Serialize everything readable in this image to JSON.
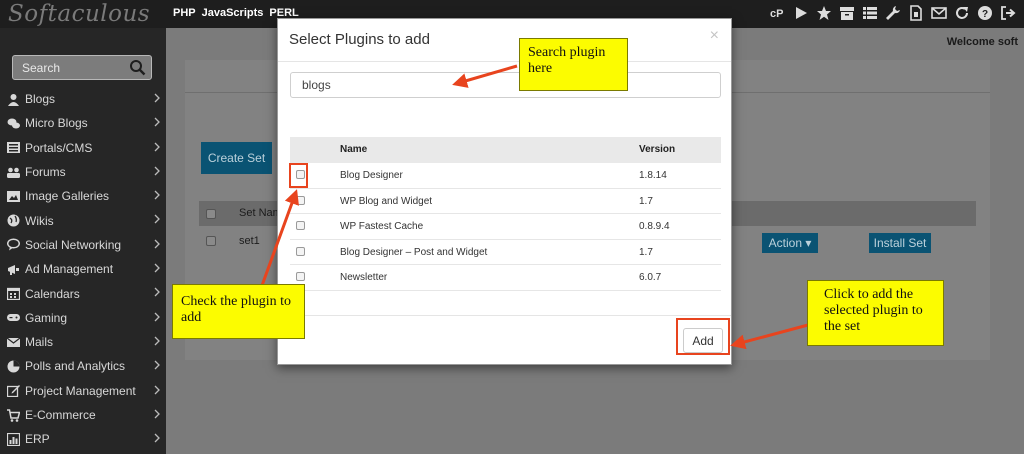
{
  "app": {
    "logo": "Softaculous",
    "top_tabs": [
      "PHP",
      "JavaScripts",
      "PERL"
    ],
    "top_icons": [
      "cpanel-icon",
      "play-icon",
      "star-icon",
      "archive-icon",
      "list-icon",
      "wrench-icon",
      "document-icon",
      "envelope-icon",
      "refresh-icon",
      "help-icon",
      "logout-icon"
    ],
    "welcome": "Welcome soft"
  },
  "sidebar": {
    "search_placeholder": "Search",
    "items": [
      {
        "label": "Blogs",
        "icon": "user-icon"
      },
      {
        "label": "Micro Blogs",
        "icon": "comments-icon"
      },
      {
        "label": "Portals/CMS",
        "icon": "list-icon"
      },
      {
        "label": "Forums",
        "icon": "group-icon"
      },
      {
        "label": "Image Galleries",
        "icon": "image-icon"
      },
      {
        "label": "Wikis",
        "icon": "globe-icon"
      },
      {
        "label": "Social Networking",
        "icon": "chat-icon"
      },
      {
        "label": "Ad Management",
        "icon": "bullhorn-icon"
      },
      {
        "label": "Calendars",
        "icon": "calendar-icon"
      },
      {
        "label": "Gaming",
        "icon": "gamepad-icon"
      },
      {
        "label": "Mails",
        "icon": "mail-icon"
      },
      {
        "label": "Polls and Analytics",
        "icon": "chart-icon"
      },
      {
        "label": "Project Management",
        "icon": "edit-icon"
      },
      {
        "label": "E-Commerce",
        "icon": "cart-icon"
      },
      {
        "label": "ERP",
        "icon": "bar-chart-icon"
      }
    ]
  },
  "background": {
    "create_set_label": "Create Set",
    "set_name_header": "Set Nam",
    "set_row_name": "set1",
    "action_label": "Action ▾",
    "install_set_label": "Install Set"
  },
  "modal": {
    "title": "Select Plugins to add",
    "close_glyph": "×",
    "search_value": "blogs",
    "columns": [
      "Name",
      "Version"
    ],
    "plugins": [
      {
        "name": "Blog Designer",
        "version": "1.8.14"
      },
      {
        "name": "WP Blog and Widget",
        "version": "1.7"
      },
      {
        "name": "WP Fastest Cache",
        "version": "0.8.9.4"
      },
      {
        "name": "Blog Designer – Post and Widget",
        "version": "1.7"
      },
      {
        "name": "Newsletter",
        "version": "6.0.7"
      }
    ],
    "add_label": "Add"
  },
  "annotations": {
    "search_note": "Search plugin here",
    "check_note": "Check the plugin to add",
    "add_note": "Click to add the selected plugin to the set",
    "highlight_color": "#e8441e",
    "callout_color": "#fcfc00"
  }
}
